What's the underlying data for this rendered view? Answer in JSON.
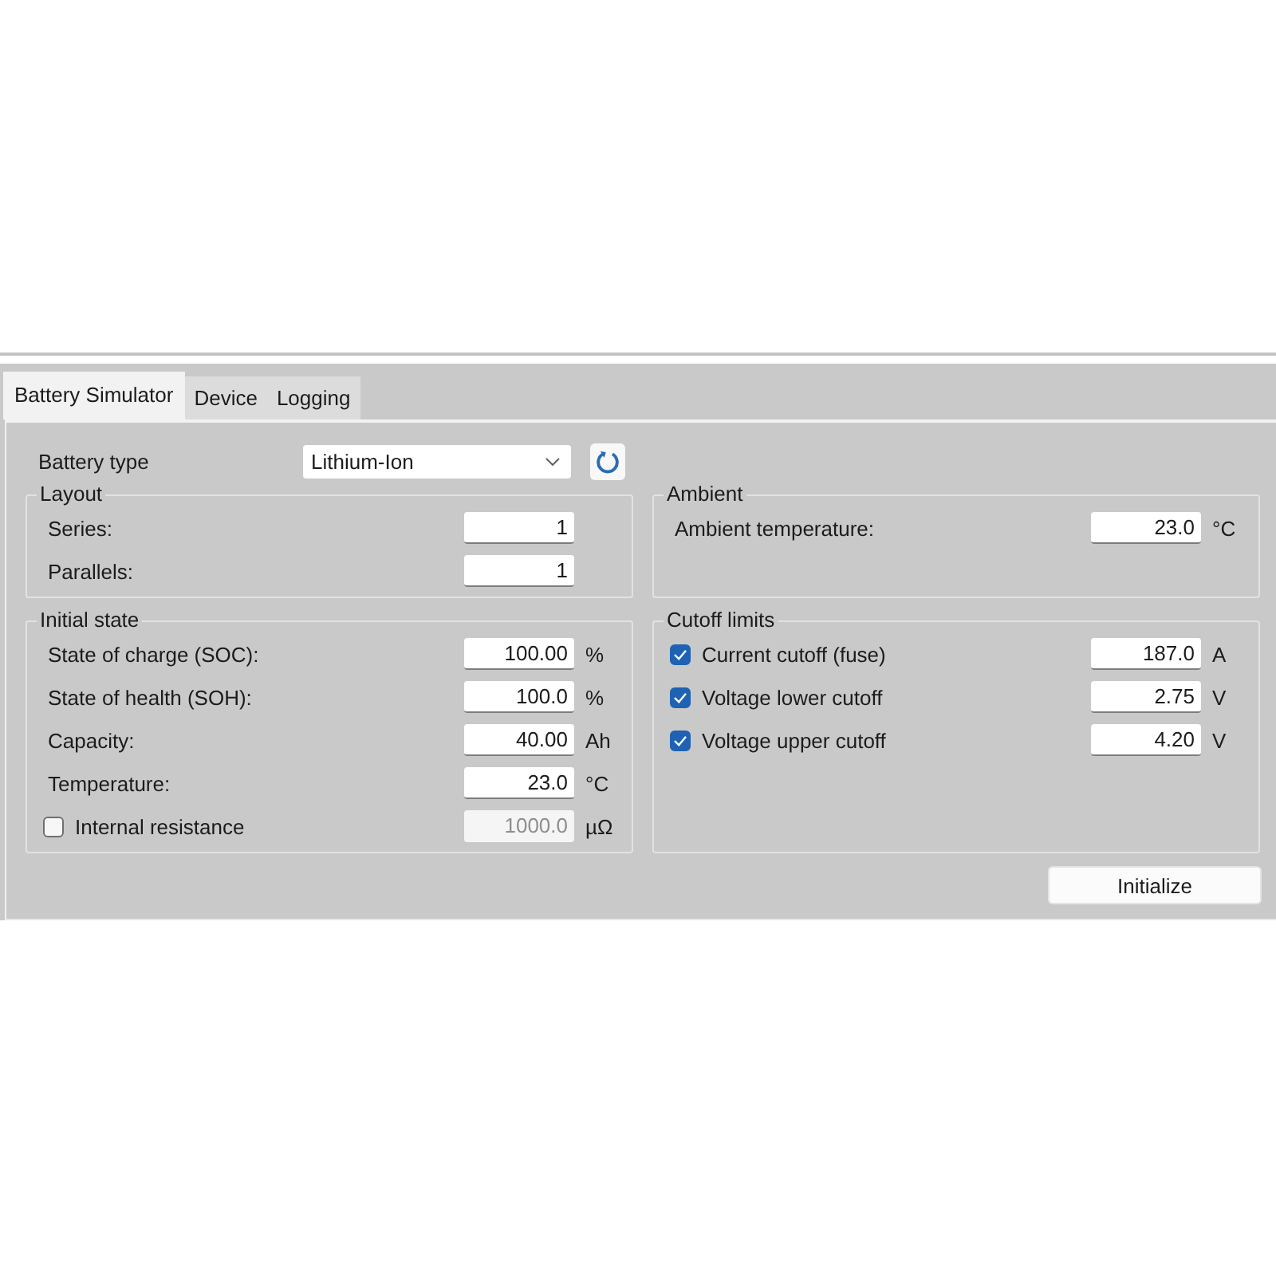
{
  "tabs": [
    {
      "label": "Battery Simulator",
      "selected": true
    },
    {
      "label": "Device",
      "selected": false
    },
    {
      "label": "Logging",
      "selected": false
    }
  ],
  "battery_type": {
    "label": "Battery type",
    "value": "Lithium-Ion"
  },
  "groups": [
    {
      "title": "Layout",
      "rows": [
        {
          "kind": "field",
          "label": "Series:",
          "value": "1"
        },
        {
          "kind": "field",
          "label": "Parallels:",
          "value": "1"
        }
      ]
    },
    {
      "title": "Ambient",
      "rows": [
        {
          "kind": "field",
          "label": "Ambient temperature:",
          "value": "23.0",
          "unit": "°C"
        }
      ]
    },
    {
      "title": "Initial state",
      "rows": [
        {
          "kind": "field",
          "label": "State of charge (SOC):",
          "value": "100.00",
          "unit": "%"
        },
        {
          "kind": "field",
          "label": "State of health (SOH):",
          "value": "100.0",
          "unit": "%"
        },
        {
          "kind": "field",
          "label": "Capacity:",
          "value": "40.00",
          "unit": "Ah"
        },
        {
          "kind": "field",
          "label": "Temperature:",
          "value": "23.0",
          "unit": "°C"
        },
        {
          "kind": "check",
          "label": "Internal resistance",
          "checked": false,
          "value": "1000.0",
          "unit": "µΩ"
        }
      ]
    },
    {
      "title": "Cutoff limits",
      "rows": [
        {
          "kind": "check",
          "label": "Current cutoff (fuse)",
          "checked": true,
          "value": "187.0",
          "unit": "A"
        },
        {
          "kind": "check",
          "label": "Voltage lower cutoff",
          "checked": true,
          "value": "2.75",
          "unit": "V"
        },
        {
          "kind": "check",
          "label": "Voltage upper cutoff",
          "checked": true,
          "value": "4.20",
          "unit": "V"
        }
      ]
    }
  ],
  "buttons": [
    {
      "label": "Initialize"
    }
  ]
}
